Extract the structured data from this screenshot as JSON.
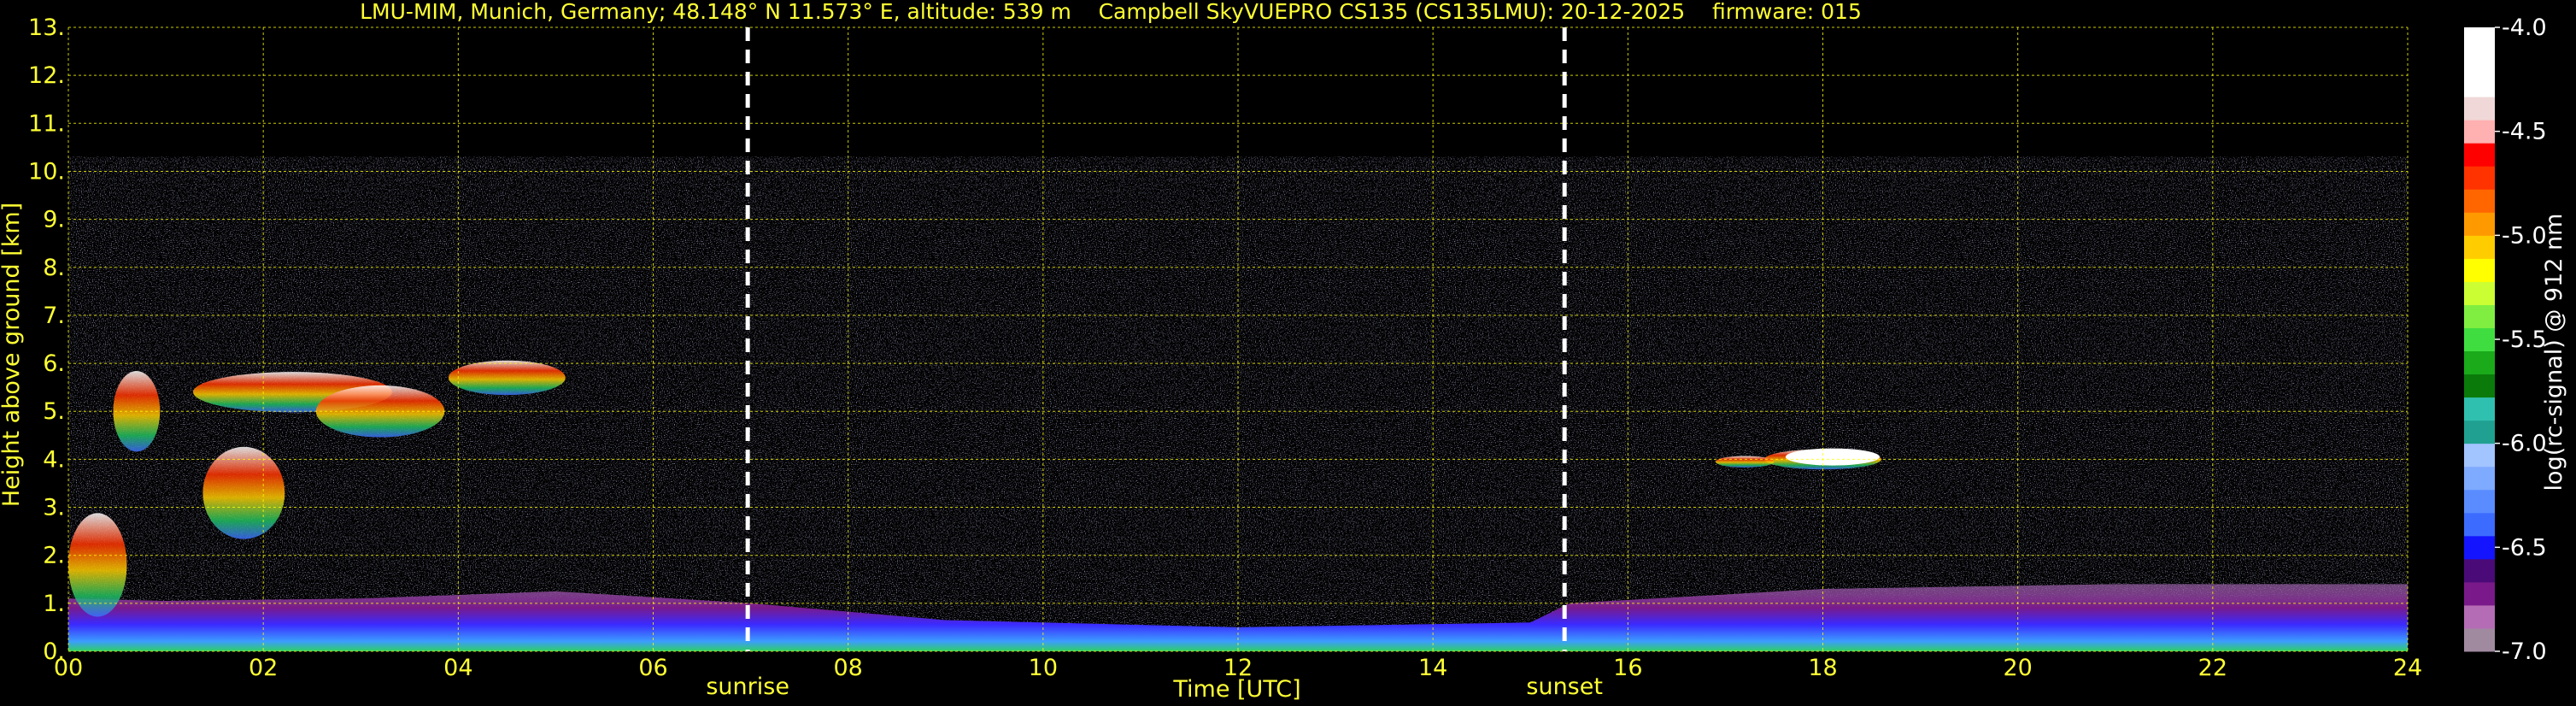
{
  "chart_data": {
    "type": "heatmap",
    "title": "LMU-MIM, Munich, Germany; 48.148° N 11.573° E, altitude: 539 m    Campbell SkyVUEPRO CS135 (CS135LMU): 20-12-2025    firmware: 015",
    "xlabel": "Time [UTC]",
    "ylabel": "Height above ground [km]",
    "xlim": [
      0,
      24
    ],
    "ylim": [
      0,
      13
    ],
    "x_ticks": [
      0,
      2,
      4,
      6,
      8,
      10,
      12,
      14,
      16,
      18,
      20,
      22,
      24
    ],
    "x_tick_labels": [
      "00",
      "02",
      "04",
      "06",
      "08",
      "10",
      "12",
      "14",
      "16",
      "18",
      "20",
      "22",
      "24"
    ],
    "y_ticks": [
      0,
      1,
      2,
      3,
      4,
      5,
      6,
      7,
      8,
      9,
      10,
      11,
      12,
      13
    ],
    "y_tick_labels": [
      "0.",
      "1.",
      "2.",
      "3.",
      "4.",
      "5.",
      "6.",
      "7.",
      "8.",
      "9.",
      "10.",
      "11.",
      "12.",
      "13."
    ],
    "grid": true,
    "grid_color": "#ffff00",
    "events": [
      {
        "label": "sunrise",
        "time": 6.97
      },
      {
        "label": "sunset",
        "time": 15.35
      }
    ],
    "colorbar": {
      "label": "log(rc-signal) @ 912 nm",
      "range": [
        -7.0,
        -4.0
      ],
      "ticks": [
        "-4.0",
        "-4.5",
        "-5.0",
        "-5.5",
        "-6.0",
        "-6.5",
        "-7.0"
      ],
      "tick_values": [
        -4.0,
        -4.5,
        -5.0,
        -5.5,
        -6.0,
        -6.5,
        -7.0
      ],
      "colors": [
        "#a08aa0",
        "#b46cb4",
        "#7a1a8a",
        "#4a0a78",
        "#1414ff",
        "#3c6cff",
        "#5a8cff",
        "#7eaaff",
        "#a2c4ff",
        "#20a090",
        "#30c0b0",
        "#0a7a0a",
        "#1aaa1a",
        "#40dd40",
        "#80ee40",
        "#ccff33",
        "#ffff00",
        "#ffcc00",
        "#ff9900",
        "#ff6600",
        "#ff3300",
        "#ff0000",
        "#ffb0b0",
        "#f0d8d8",
        "#ffffff",
        "#ffffff",
        "#ffffff"
      ]
    }
  }
}
